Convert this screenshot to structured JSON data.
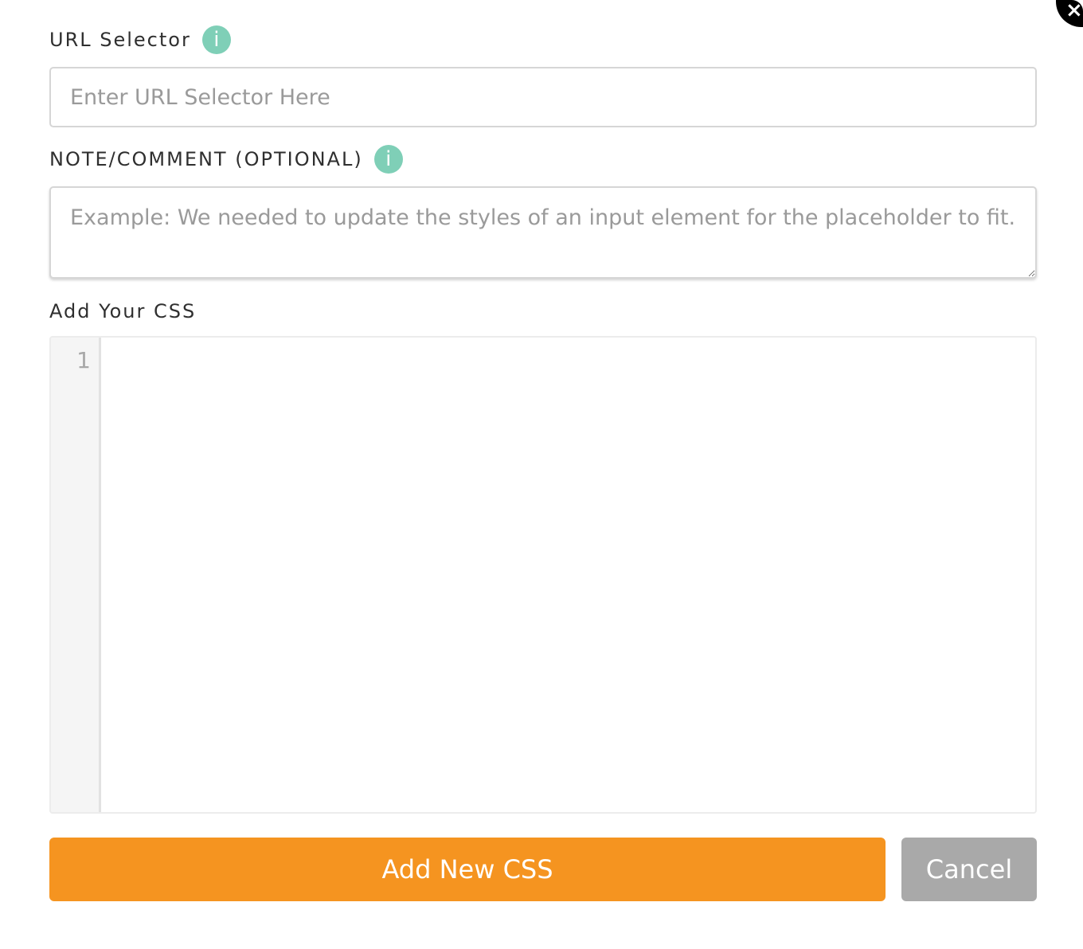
{
  "modal": {
    "close_label": "×"
  },
  "url_selector": {
    "label": "URL Selector",
    "info_icon": "i",
    "placeholder": "Enter URL Selector Here",
    "value": ""
  },
  "note": {
    "label": "NOTE/COMMENT (OPTIONAL)",
    "info_icon": "i",
    "placeholder": "Example: We needed to update the styles of an input element for the placeholder to fit.",
    "value": ""
  },
  "css_editor": {
    "label": "Add Your CSS",
    "line_numbers": [
      "1"
    ],
    "content": ""
  },
  "actions": {
    "submit_label": "Add New CSS",
    "cancel_label": "Cancel"
  },
  "colors": {
    "accent": "#f59420",
    "info": "#7fcfb7",
    "cancel": "#a9a9a9"
  },
  "icons": {
    "close": "close-icon",
    "info": "info-icon"
  }
}
